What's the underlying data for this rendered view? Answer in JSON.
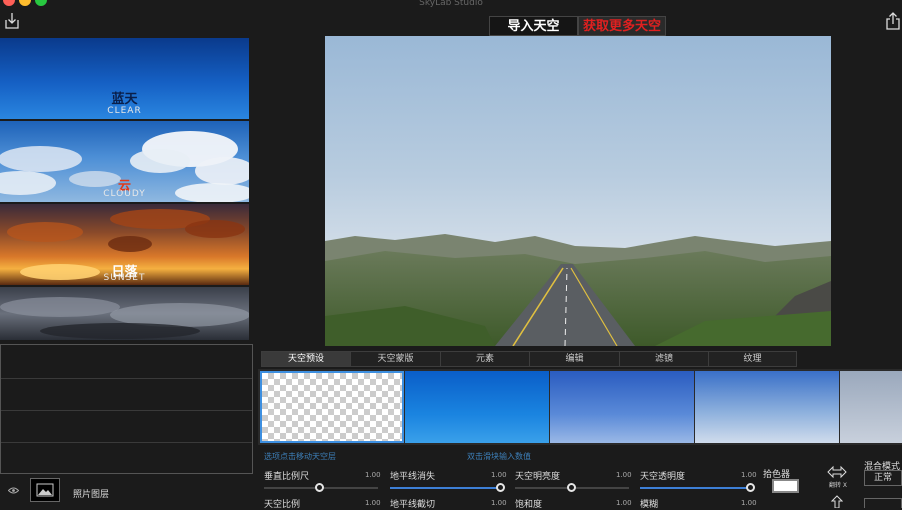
{
  "app": {
    "title": "SkyLab Studio"
  },
  "toolbar": {
    "import_label": "导入天空",
    "get_more_label": "获取更多天空"
  },
  "sky_list": [
    {
      "cn": "蓝天",
      "en": "CLEAR"
    },
    {
      "cn": "云",
      "en": "CLOUDY"
    },
    {
      "cn": "日落",
      "en": "SUNSET"
    },
    {
      "cn": "",
      "en": ""
    }
  ],
  "layers": {
    "photo_layer_label": "照片图层",
    "eye_icon": "eye-icon",
    "photo_icon": "image-icon"
  },
  "tabs": [
    {
      "label": "天空预设",
      "active": true
    },
    {
      "label": "天空蒙版",
      "active": false
    },
    {
      "label": "元素",
      "active": false
    },
    {
      "label": "编辑",
      "active": false
    },
    {
      "label": "滤镜",
      "active": false
    },
    {
      "label": "纹理",
      "active": false
    }
  ],
  "hints": {
    "left": "选项点击移动天空层",
    "right": "双击滑块输入数值"
  },
  "controls": {
    "vertical_scale": {
      "label": "垂直比例尺",
      "value": "1.00",
      "level": 0.0
    },
    "horizon_fade": {
      "label": "地平线消失",
      "value": "1.00",
      "level": 1.0
    },
    "sky_brightness": {
      "label": "天空明亮度",
      "value": "1.00",
      "level": 0.0
    },
    "sky_opacity": {
      "label": "天空透明度",
      "value": "1.00",
      "level": 1.0
    },
    "sky_scale": {
      "label": "天空比例",
      "value": "1.00"
    },
    "horizon_cut": {
      "label": "地平线截切",
      "value": "1.00"
    },
    "saturation": {
      "label": "饱和度",
      "value": "1.00"
    },
    "blur": {
      "label": "模糊",
      "value": "1.00"
    }
  },
  "color_picker": {
    "label": "拾色器",
    "color": "#ffffff"
  },
  "flip": {
    "label": "翻转 X"
  },
  "blend": {
    "label": "混合模式",
    "value": "正常"
  },
  "colors": {
    "accent": "#3d7fd6",
    "highlight": "#e02020",
    "background": "#1b1b1b"
  }
}
